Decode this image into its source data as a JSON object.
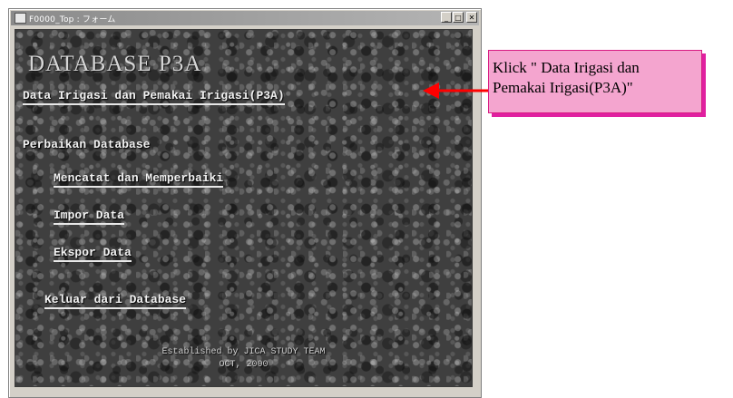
{
  "window": {
    "title": "F0000_Top : フォーム",
    "controls": {
      "minimize": "_",
      "maximize": "□",
      "close": "✕"
    }
  },
  "main": {
    "title": "DATABASE P3A",
    "links": {
      "data_irigasi": "Data Irigasi dan Pemakai Irigasi(P3A)",
      "mencatat": "Mencatat dan Memperbaiki",
      "impor": "Impor Data",
      "ekspor": "Ekspor Data",
      "keluar": "Keluar dari Database"
    },
    "section_label": "Perbaikan Database",
    "footer": {
      "line1": "Established by JICA STUDY TEAM",
      "line2": "OCT, 2000"
    }
  },
  "callout": {
    "line1": "Klick \" Data Irigasi dan",
    "line2": "Pemakai Irigasi(P3A)\""
  },
  "colors": {
    "callout_fill": "#f4a5cf",
    "callout_border": "#d81b83",
    "arrow": "#ff0000"
  }
}
